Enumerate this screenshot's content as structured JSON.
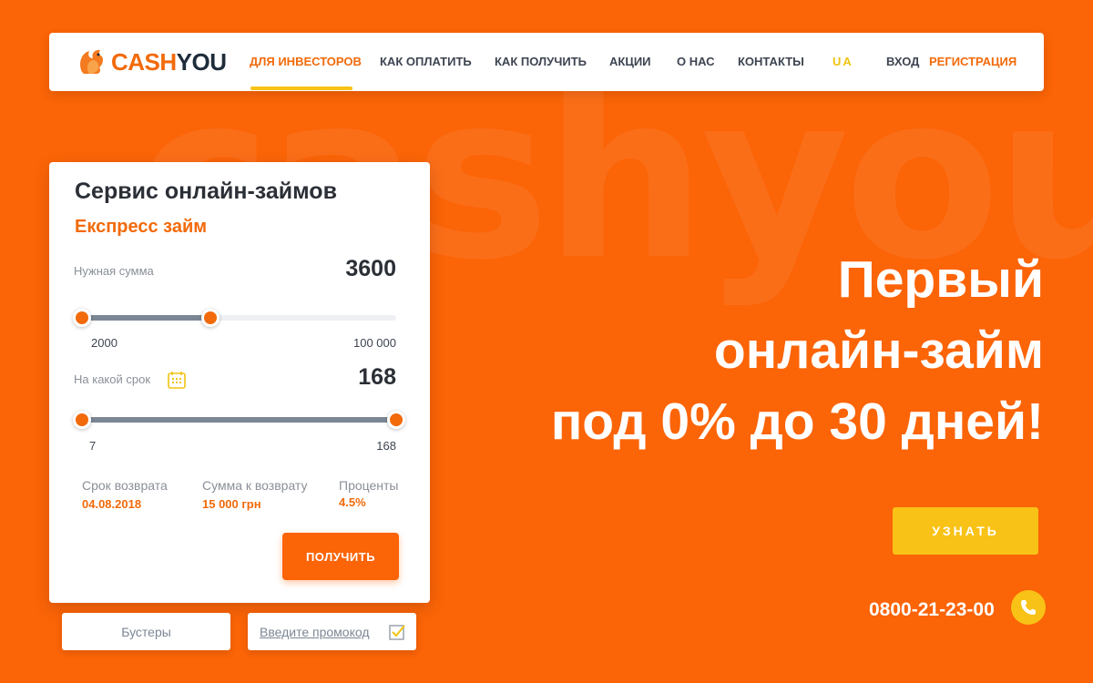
{
  "watermark": "cashyou",
  "header": {
    "logo": {
      "part1": "CASH",
      "part2": "YOU"
    },
    "nav": [
      "ДЛЯ ИНВЕСТОРОВ",
      "КАК ОПЛАТИТЬ",
      "КАК ПОЛУЧИТЬ",
      "АКЦИИ",
      "О НАС",
      "КОНТАКТЫ"
    ],
    "lang": "UA",
    "login": "ВХОД",
    "register": "РЕГИСТРАЦИЯ"
  },
  "calculator": {
    "title": "Сервис онлайн-займов",
    "subtitle": "Експресс займ",
    "amount": {
      "label": "Нужная сумма",
      "value": "3600",
      "min": "2000",
      "max": "100 000",
      "fraction": 0.41
    },
    "term": {
      "label": "На какой срок",
      "value": "168",
      "min": "7",
      "max": "168",
      "fraction": 1.0
    },
    "info": [
      {
        "label": "Срок возврата",
        "value": "04.08.2018"
      },
      {
        "label": "Сумма к возврату",
        "value": "15 000 грн"
      },
      {
        "label": "Проценты",
        "value": "4.5%"
      }
    ],
    "submit": "ПОЛУЧИТЬ"
  },
  "boosters": "Бустеры",
  "promo_placeholder": "Введите промокод",
  "hero": {
    "line1": "Первый",
    "line2": "онлайн-займ",
    "line3": "под 0% до 30 дней!"
  },
  "learn_button": "УЗНАТЬ",
  "phone": "0800-21-23-00",
  "colors": {
    "background": "#fb6407",
    "accent": "#f26a0a",
    "yellow": "#f8c216"
  }
}
